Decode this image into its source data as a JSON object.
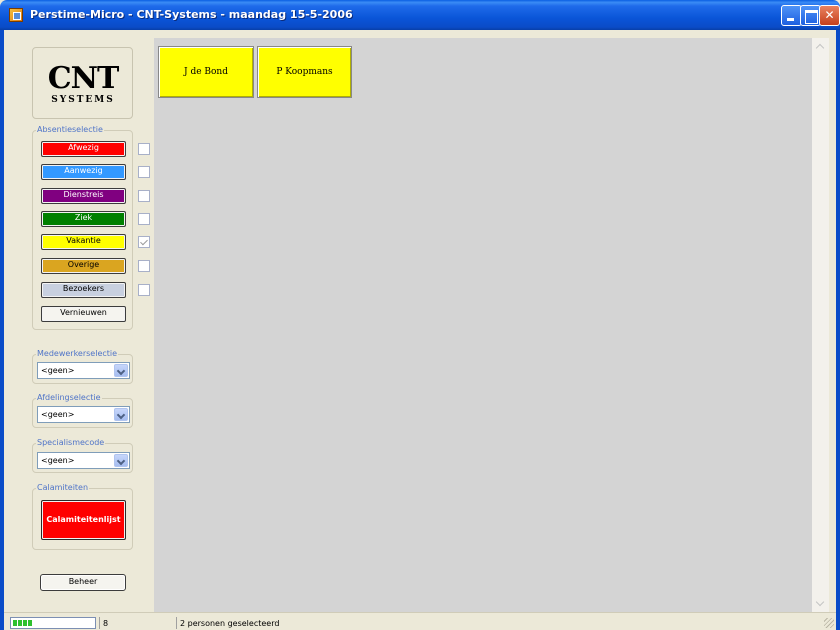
{
  "window": {
    "title": "Perstime-Micro - CNT-Systems - maandag 15-5-2006"
  },
  "logo": {
    "line1": "CNT",
    "line2": "SYSTEMS"
  },
  "absence": {
    "legend": "Absentieselectie",
    "buttons": [
      {
        "label": "Afwezig",
        "color": "#ff0000",
        "text_color": "#ffffff",
        "checked": false
      },
      {
        "label": "Aanwezig",
        "color": "#3399ff",
        "text_color": "#ffffff",
        "checked": false
      },
      {
        "label": "Dienstreis",
        "color": "#800080",
        "text_color": "#ffffff",
        "checked": false
      },
      {
        "label": "Ziek",
        "color": "#008000",
        "text_color": "#ffffff",
        "checked": false
      },
      {
        "label": "Vakantie",
        "color": "#ffff00",
        "text_color": "#000000",
        "checked": true
      },
      {
        "label": "Overige",
        "color": "#daa520",
        "text_color": "#000000",
        "checked": false
      },
      {
        "label": "Bezoekers",
        "color": "#c8d0e0",
        "text_color": "#000000",
        "checked": false
      }
    ],
    "refresh_label": "Vernieuwen"
  },
  "employee_select": {
    "legend": "Medewerkerselectie",
    "value": "<geen>"
  },
  "department_select": {
    "legend": "Afdelingselectie",
    "value": "<geen>"
  },
  "specialism_select": {
    "legend": "Specialismecode",
    "value": "<geen>"
  },
  "calamities": {
    "legend": "Calamiteiten",
    "button_label": "Calamiteitenlijst"
  },
  "admin": {
    "button_label": "Beheer"
  },
  "persons": [
    {
      "name": "J de Bond"
    },
    {
      "name": "P Koopmans"
    }
  ],
  "status": {
    "progress_segments": 4,
    "count": "8",
    "message": "2 personen geselecteerd"
  }
}
